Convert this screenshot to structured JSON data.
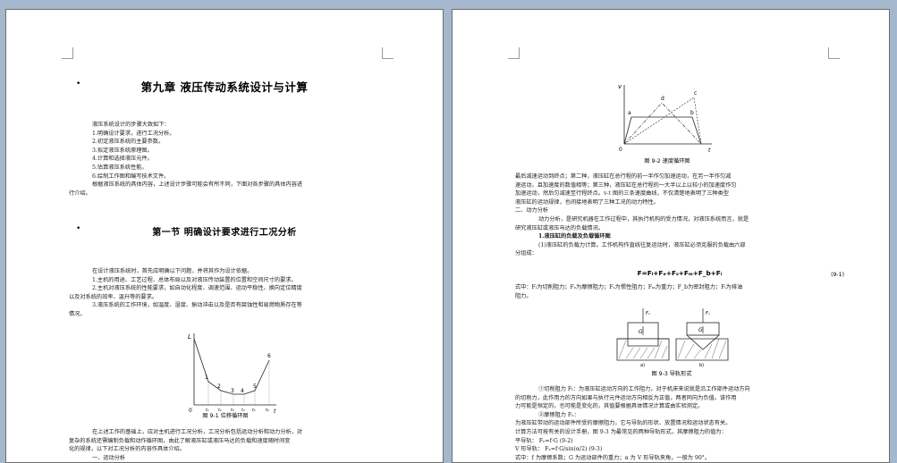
{
  "left_page": {
    "chapter_title": "第九章 液压传动系统设计与计算",
    "intro_lines": [
      "液压系统设计的步骤大致如下：",
      "1.明确设计要求，进行工况分析。",
      "2.初定液压系统的主要参数。",
      "3.拟定液压系统原理图。",
      "4.计算和选择液压元件。",
      "5.估算液压系统性能。",
      "6.绘制工作图和编写技术文件。",
      "根据液压系统的具体内容，上述设计步骤可能会有所不同，下面对各步骤的具体内容进",
      "行介绍。"
    ],
    "section_title": "第一节   明确设计要求进行工况分析",
    "section_lines": [
      "在设计液压系统时，首先应明确以下问题，并将其作为设计依据。",
      "1.主机的用途、工艺过程、总体布局以及对液压传动装置的位置和空间尺寸的要求。",
      "2.主机对液压系统的性能要求，如自动化程度、调速范围、运动平稳性、换向定位精度",
      "以及对系统的效率、温升等的要求。",
      "3.液压系统的工作环境，如温度、湿度、振动冲击以及是否有腐蚀性和易燃物质存在等",
      "情况。"
    ],
    "figure": {
      "y_label": "L",
      "origin": "0",
      "point_labels": [
        "1",
        "2",
        "3",
        "4",
        "5",
        "6"
      ],
      "x_ticks": [
        "t₁",
        "t₂",
        "t₃",
        "t₄",
        "t₅",
        "t₆"
      ],
      "x_label": "t",
      "caption": "图 9-1 位移循环图"
    },
    "after_lines": [
      "在上述工作的基础上，应对主机进行工况分析，工况分析包括运动分析和动力分析，对",
      "复杂的系统还需编制负载和动作循环图，由此了解液压缸或液压马达的负载和速度随时间变",
      "化的规律，以下对工况分析的内容作具体介绍。",
      "一、运动分析"
    ]
  },
  "right_page": {
    "figure_top": {
      "y_label": "v",
      "origin": "0",
      "x_label": "t",
      "point_labels": [
        "a",
        "b",
        "c",
        "d"
      ],
      "caption": "图 9-2 速度循环图"
    },
    "lines_a": [
      "最后减速运动到终点；第二种，液压缸在总行程的前一半作匀加速运动，在另一半作匀减",
      "速运动，且加速度的数值相等；第三种，液压缸在总行程的一大半以上以较小的加速度作匀",
      "加速运动，然后匀减速至行程终点。v-t 图的三条速度曲线，不仅清楚地表明了三种类型",
      "液压缸的运动规律，也间接地表明了三种工况的动力特性。"
    ],
    "heading_dynamic": "二、动力分析",
    "dynamic_lines": [
      "动力分析，是研究机器在工作过程中，其执行机构的受力情况，对液压系统而言，就是",
      "研究液压缸或液压马达的负载情况。"
    ],
    "sub1": "1.液压缸的负载及负载循环图",
    "sub1_lines": [
      "(1)液压缸的负载力计算。工作机构作直线往复运动时，液压缸必须克服的负载由六部",
      "分组成："
    ],
    "formula": "F=Fₗ+Fₑ+Fₛ+Fₘ+F_b+Fᵢ",
    "formula_no": "(9-1)",
    "formula_desc": [
      "式中：Fₗ为切削阻力；Fₑ为摩擦阻力；Fₛ为惯性阻力；Fₘ为重力；F_b为密封阻力；Fᵢ为排油",
      "阻力。"
    ],
    "figure_guide": {
      "labels": [
        "Fₙ",
        "G",
        "Fₙ",
        "G"
      ],
      "sub_labels": [
        "a)",
        "b)"
      ],
      "caption": "图 9-3 导轨形式"
    },
    "friction_lines": [
      "①切削阻力 Fₗ：为液压缸运动方向的工作阻力，对于机床来说就是沿工作部件运动方向",
      "的切削力，此作用力的方向如果与执行元件运动方向相反为正值，两者同向为负值。该作用",
      "力可能是恒定的，也可能是变化的，其值要根据具体情况计算或由实验测定。",
      "②摩擦阻力 Fₑ：",
      "为液压缸带动的运动部件所受的摩擦阻力，它与导轨的形状、放置情况和运动状态有关。",
      "计算方法可按有关的设计手册，图 9-3 为最常见的两种导轨形式，其摩擦阻力的值为：",
      "平导轨：          Fₑ=f·G                              (9-2)",
      "V 形导轨：        Fₑ=f·G/sin(α/2)                     (9-3)",
      "式中：f 为摩擦系数；G 为运动部件的重力；α 为 V 形导轨夹角，一般为 90°。"
    ]
  }
}
